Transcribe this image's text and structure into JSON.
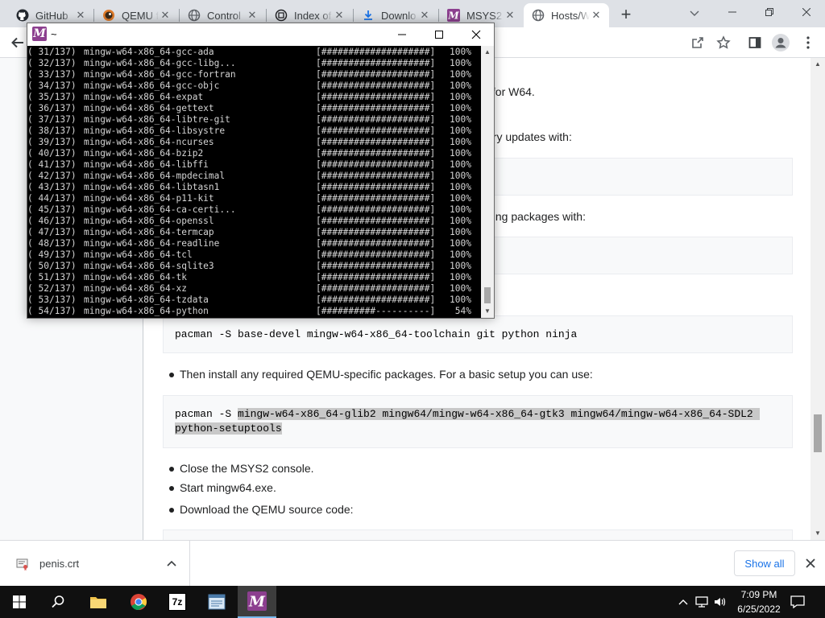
{
  "colors": {
    "tab_strip": "#dee1e6",
    "terminal_bg": "#000000",
    "terminal_text": "#d4d4d4",
    "msys2_brand": "#8c3f8f",
    "link_blue": "#1a73e8",
    "taskbar": "#101010"
  },
  "browser": {
    "tabs": [
      {
        "title": "GitHub",
        "icon": "github-icon"
      },
      {
        "title": "QEMU f",
        "icon": "qemu-icon"
      },
      {
        "title": "Control",
        "icon": "globe-icon"
      },
      {
        "title": "Index of",
        "icon": "archive-icon"
      },
      {
        "title": "Downlo",
        "icon": "download-icon"
      },
      {
        "title": "MSYS2",
        "icon": "msys2-icon"
      },
      {
        "title": "Hosts/W",
        "icon": "globe-icon",
        "active": true
      }
    ],
    "new_tab_label": "+"
  },
  "page": {
    "partial_lines": [
      "s for W64.",
      "ory updates with:",
      "hing packages with:"
    ],
    "toolchain_command": "pacman -S base-devel mingw-w64-x86_64-toolchain git python ninja",
    "bullet_qemu_packages": "Then install any required QEMU-specific packages. For a basic setup you can use:",
    "qemu_cmd_prefix": "pacman -S ",
    "qemu_cmd_selected_1": "mingw-w64-x86_64-glib2 mingw64/mingw-w64-x86_64-gtk3 mingw64/mingw-w64-x86_64-SDL2 ",
    "qemu_cmd_selected_2": "python-setuptools",
    "bullets": [
      "Close the MSYS2 console.",
      "Start mingw64.exe.",
      "Download the QEMU source code:"
    ]
  },
  "terminal": {
    "title": "~",
    "logo_letter": "M",
    "lines": [
      {
        "n": "( 31/137)",
        "pkg": "mingw-w64-x86_64-gcc-ada",
        "bar": "[####################]",
        "pct": "100%"
      },
      {
        "n": "( 32/137)",
        "pkg": "mingw-w64-x86_64-gcc-libg...",
        "bar": "[####################]",
        "pct": "100%"
      },
      {
        "n": "( 33/137)",
        "pkg": "mingw-w64-x86_64-gcc-fortran",
        "bar": "[####################]",
        "pct": "100%"
      },
      {
        "n": "( 34/137)",
        "pkg": "mingw-w64-x86_64-gcc-objc",
        "bar": "[####################]",
        "pct": "100%"
      },
      {
        "n": "( 35/137)",
        "pkg": "mingw-w64-x86_64-expat",
        "bar": "[####################]",
        "pct": "100%"
      },
      {
        "n": "( 36/137)",
        "pkg": "mingw-w64-x86_64-gettext",
        "bar": "[####################]",
        "pct": "100%"
      },
      {
        "n": "( 37/137)",
        "pkg": "mingw-w64-x86_64-libtre-git",
        "bar": "[####################]",
        "pct": "100%"
      },
      {
        "n": "( 38/137)",
        "pkg": "mingw-w64-x86_64-libsystre",
        "bar": "[####################]",
        "pct": "100%"
      },
      {
        "n": "( 39/137)",
        "pkg": "mingw-w64-x86_64-ncurses",
        "bar": "[####################]",
        "pct": "100%"
      },
      {
        "n": "( 40/137)",
        "pkg": "mingw-w64-x86_64-bzip2",
        "bar": "[####################]",
        "pct": "100%"
      },
      {
        "n": "( 41/137)",
        "pkg": "mingw-w64-x86_64-libffi",
        "bar": "[####################]",
        "pct": "100%"
      },
      {
        "n": "( 42/137)",
        "pkg": "mingw-w64-x86_64-mpdecimal",
        "bar": "[####################]",
        "pct": "100%"
      },
      {
        "n": "( 43/137)",
        "pkg": "mingw-w64-x86_64-libtasn1",
        "bar": "[####################]",
        "pct": "100%"
      },
      {
        "n": "( 44/137)",
        "pkg": "mingw-w64-x86_64-p11-kit",
        "bar": "[####################]",
        "pct": "100%"
      },
      {
        "n": "( 45/137)",
        "pkg": "mingw-w64-x86_64-ca-certi...",
        "bar": "[####################]",
        "pct": "100%"
      },
      {
        "n": "( 46/137)",
        "pkg": "mingw-w64-x86_64-openssl",
        "bar": "[####################]",
        "pct": "100%"
      },
      {
        "n": "( 47/137)",
        "pkg": "mingw-w64-x86_64-termcap",
        "bar": "[####################]",
        "pct": "100%"
      },
      {
        "n": "( 48/137)",
        "pkg": "mingw-w64-x86_64-readline",
        "bar": "[####################]",
        "pct": "100%"
      },
      {
        "n": "( 49/137)",
        "pkg": "mingw-w64-x86_64-tcl",
        "bar": "[####################]",
        "pct": "100%"
      },
      {
        "n": "( 50/137)",
        "pkg": "mingw-w64-x86_64-sqlite3",
        "bar": "[####################]",
        "pct": "100%"
      },
      {
        "n": "( 51/137)",
        "pkg": "mingw-w64-x86_64-tk",
        "bar": "[####################]",
        "pct": "100%"
      },
      {
        "n": "( 52/137)",
        "pkg": "mingw-w64-x86_64-xz",
        "bar": "[####################]",
        "pct": "100%"
      },
      {
        "n": "( 53/137)",
        "pkg": "mingw-w64-x86_64-tzdata",
        "bar": "[####################]",
        "pct": "100%"
      },
      {
        "n": "( 54/137)",
        "pkg": "mingw-w64-x86_64-python",
        "bar": "[##########----------]",
        "pct": " 54%"
      }
    ]
  },
  "downloads": {
    "file_name": "penis.crt",
    "show_all_label": "Show all"
  },
  "taskbar": {
    "time": "7:09 PM",
    "date": "6/25/2022",
    "apps": [
      "start-button",
      "search-icon",
      "file-explorer-icon",
      "chrome-icon",
      "7zip-icon",
      "notepad-icon",
      "msys2-taskbar-icon"
    ],
    "sevenzip_label": "7z"
  }
}
